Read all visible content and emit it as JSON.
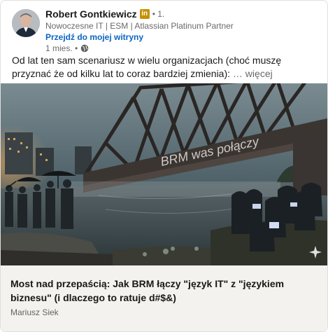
{
  "author": {
    "name": "Robert Gontkiewicz",
    "badge": "in",
    "degree": "• 1.",
    "headline": "Nowoczesne IT | ESM | Atlassian Platinum Partner",
    "profile_link": "Przejdź do mojej witryny",
    "timestamp": "1 mies. •",
    "visibility_icon": "globe-icon",
    "avatar": "avatar"
  },
  "post": {
    "text": "Od lat ten sam scenariusz w wielu organizacjach (choć muszę przyznać że od kilku lat to coraz bardziej zmienia):",
    "more": "… więcej"
  },
  "image": {
    "graffiti": "BRM was połączy",
    "sparkle_icon": "sparkle-icon"
  },
  "article": {
    "title": "Most nad przepaścią: Jak BRM łączy \"język IT\" z \"językiem biznesu\" (i dlaczego to ratuje d#$&)",
    "author": "Mariusz Siek"
  },
  "colors": {
    "link": "#0a66c2",
    "premium_badge": "#c79100",
    "article_bg": "#f4f2ee"
  }
}
